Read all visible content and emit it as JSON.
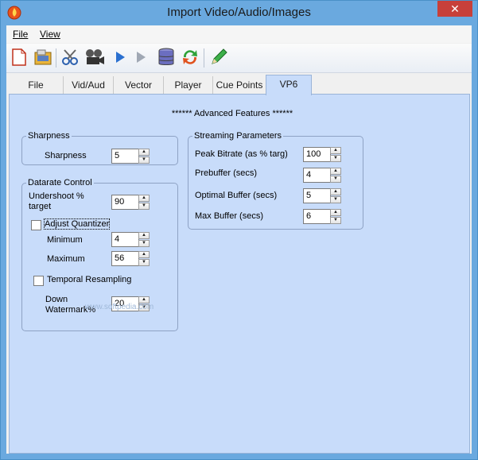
{
  "window": {
    "title": "Import Video/Audio/Images",
    "close_glyph": "✕"
  },
  "menu": {
    "file": "File",
    "view": "View"
  },
  "toolbar": {
    "icons": [
      "new-document-icon",
      "open-folder-icon",
      "scissors-icon",
      "film-reel-icon",
      "play-icon",
      "play-disabled-icon",
      "database-icon",
      "refresh-icon",
      "pencil-icon"
    ]
  },
  "tabs": [
    "File",
    "Vid/Aud",
    "Vector",
    "Player",
    "Cue Points",
    "VP6"
  ],
  "active_tab": "VP6",
  "panel": {
    "advanced_title": "****** Advanced Features ******",
    "sharpness": {
      "legend": "Sharpness",
      "label": "Sharpness",
      "value": "5"
    },
    "datarate": {
      "legend": "Datarate Control",
      "undershoot_label": "Undershoot % target",
      "undershoot_value": "90",
      "adjust_quantizer_label": "Adjust Quantizer",
      "adjust_quantizer_checked": false,
      "minimum_label": "Minimum",
      "minimum_value": "4",
      "maximum_label": "Maximum",
      "maximum_value": "56",
      "temporal_resampling_label": "Temporal Resampling",
      "temporal_resampling_checked": false,
      "down_watermark_label": "Down Watermark%",
      "down_watermark_value": "20"
    },
    "streaming": {
      "legend": "Streaming Parameters",
      "peak_bitrate_label": "Peak Bitrate (as % targ)",
      "peak_bitrate_value": "100",
      "prebuffer_label": "Prebuffer (secs)",
      "prebuffer_value": "4",
      "optimal_buffer_label": "Optimal Buffer (secs)",
      "optimal_buffer_value": "5",
      "max_buffer_label": "Max Buffer (secs)",
      "max_buffer_value": "6"
    },
    "watermark_text": "www.softpedia.com"
  }
}
